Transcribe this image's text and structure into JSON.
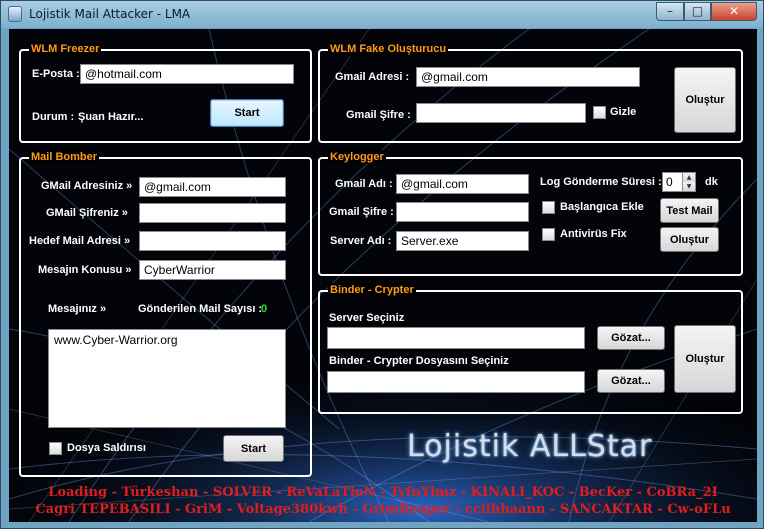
{
  "window": {
    "title": "Lojistik Mail Attacker - LMA"
  },
  "wlm_freezer": {
    "title": "WLM Freezer",
    "email_label": "E-Posta :",
    "email_value": "@hotmail.com",
    "status_label": "Durum :",
    "status_value": "Şuan Hazır...",
    "start_label": "Start"
  },
  "wlm_fake": {
    "title": "WLM Fake Oluşturucu",
    "gmail_label": "Gmail Adresi :",
    "gmail_value": "@gmail.com",
    "password_label": "Gmail Şifre :",
    "password_value": "",
    "hide_label": "Gizle",
    "create_label": "Oluştur"
  },
  "mail_bomber": {
    "title": "Mail Bomber",
    "gmail_label": "GMail Adresiniz »",
    "gmail_value": "@gmail.com",
    "password_label": "GMail Şifreniz »",
    "password_value": "",
    "target_label": "Hedef Mail Adresi »",
    "target_value": "",
    "subject_label": "Mesajın Konusu »",
    "subject_value": "CyberWarrior",
    "message_label": "Mesajınız »",
    "sent_label": "Gönderilen Mail Sayısı :",
    "sent_count": "0",
    "message_value": "www.Cyber-Warrior.org",
    "file_attack_label": "Dosya Saldırısı",
    "start_label": "Start"
  },
  "keylogger": {
    "title": "Keylogger",
    "gmail_label": "Gmail Adı :",
    "gmail_value": "@gmail.com",
    "password_label": "Gmail Şifre :",
    "password_value": "",
    "server_label": "Server Adı :",
    "server_value": "Server.exe",
    "log_interval_label": "Log Gönderme Süresi :",
    "log_interval_value": "0",
    "log_interval_unit": "dk",
    "startup_label": "Başlangıca Ekle",
    "antivirus_label": "Antivirüs Fix",
    "test_mail_label": "Test Mail",
    "create_label": "Oluştur"
  },
  "binder": {
    "title": "Binder - Crypter",
    "server_label": "Server Seçiniz",
    "server_value": "",
    "browse1_label": "Gözat...",
    "file_label": "Binder - Crypter Dosyasını Seçiniz",
    "file_value": "",
    "browse2_label": "Gözat...",
    "create_label": "Oluştur"
  },
  "logo_text": "Lojistik ALLStar",
  "credits": {
    "line1": "Loading - Türkeshan - SOLVER - ReVaLaTioN - TyfnYlmz - KINALI_KOC - BecKer - CoBRa_2I",
    "line2": "Cagri TEPEBASILI - GriM - Voltage380kwh - GrimReaper - cciihhaann - SANCAKTAR - Cw-oFLu"
  },
  "colors": {
    "group_title": "#ff9a1a",
    "credits": "#e01e1e",
    "count": "#29e629"
  }
}
